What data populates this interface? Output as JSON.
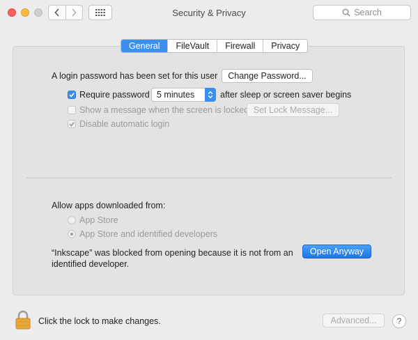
{
  "window": {
    "title": "Security & Privacy"
  },
  "search": {
    "placeholder": "Search",
    "icon": "magnifier-icon"
  },
  "tabs": [
    {
      "label": "General",
      "active": true
    },
    {
      "label": "FileVault",
      "active": false
    },
    {
      "label": "Firewall",
      "active": false
    },
    {
      "label": "Privacy",
      "active": false
    }
  ],
  "general": {
    "login_text": "A login password has been set for this user",
    "change_password_button": "Change Password...",
    "require_password": {
      "label": "Require password",
      "checked": true
    },
    "require_select_value": "5 minutes",
    "require_suffix": "after sleep or screen saver begins",
    "show_message": {
      "label": "Show a message when the screen is locked",
      "checked": false,
      "enabled": false
    },
    "set_lock_message_button": "Set Lock Message...",
    "disable_auto_login": {
      "label": "Disable automatic login",
      "checked": true,
      "enabled": false
    }
  },
  "apps": {
    "heading": "Allow apps downloaded from:",
    "option_app_store": "App Store",
    "option_identified": "App Store and identified developers",
    "selected": "App Store and identified developers",
    "blocked_line1": "“Inkscape” was blocked from opening because it is not from an",
    "blocked_line2": "identified developer.",
    "open_anyway_button": "Open Anyway"
  },
  "footer": {
    "lock_text": "Click the lock to make changes.",
    "advanced_button": "Advanced...",
    "help_label": "?"
  },
  "colors": {
    "accent": "#3a8ff0",
    "background": "#ececec",
    "panel": "#e3e3e3",
    "lock": "#e9a93a"
  }
}
